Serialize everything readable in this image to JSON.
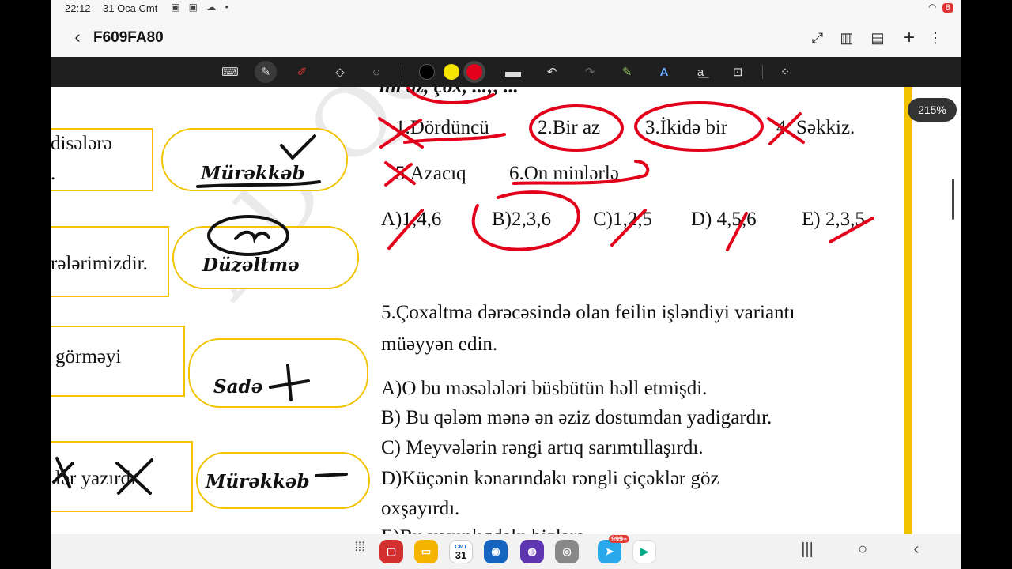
{
  "status": {
    "time": "22:12",
    "date": "31 Oca Cmt",
    "battery": "8"
  },
  "titlebar": {
    "back": "‹",
    "title": "F609FA80"
  },
  "zoom": "215%",
  "left_column": {
    "text_1": "disələrə",
    "text_1b": ".",
    "text_2": "rələrimizdir.",
    "text_3": "görməyi",
    "text_4": "lər yazırdı."
  },
  "pills": [
    "Mürəkkəb",
    "Düzəltmə",
    "Sadə",
    "Mürəkkəb"
  ],
  "question4": {
    "top_cut": "ını az, çox, ...;, ...",
    "items_row1": [
      "1.Dördüncü",
      "2.Bir az",
      "3.İkidə bir",
      "4. Səkkiz."
    ],
    "items_row2": [
      "5.Azacıq",
      "6.On minlərlə"
    ],
    "answers": [
      "A)1,4,6",
      "B)2,3,6",
      "C)1,2,5",
      "D) 4,5,6",
      "E) 2,3,5"
    ]
  },
  "question5": {
    "title_line1": "5.Çoxaltma dərəcəsində olan feilin işləndiyi variantı",
    "title_line2": "müəyyən edin.",
    "options": [
      "A)O bu məsələləri büsbütün həll etmişdi.",
      "B) Bu qələm mənə ən əziz dostumdan yadigardır.",
      "C) Meyvələrin rəngi artıq sarımtıllaşırdı.",
      "D)Küçənin kənarındakı rəngli çiçəklər göz",
      "oxşayırdı.",
      "E)Bu yaxınlıqdakı bizlərə ..."
    ]
  },
  "dock": {
    "calendar_day": "31",
    "calendar_month": "CMT",
    "badge": "999+"
  },
  "colors": {
    "accent_yellow": "#f2c300",
    "ink_red": "#e3001b",
    "toolbar": "#1f1f1f"
  }
}
